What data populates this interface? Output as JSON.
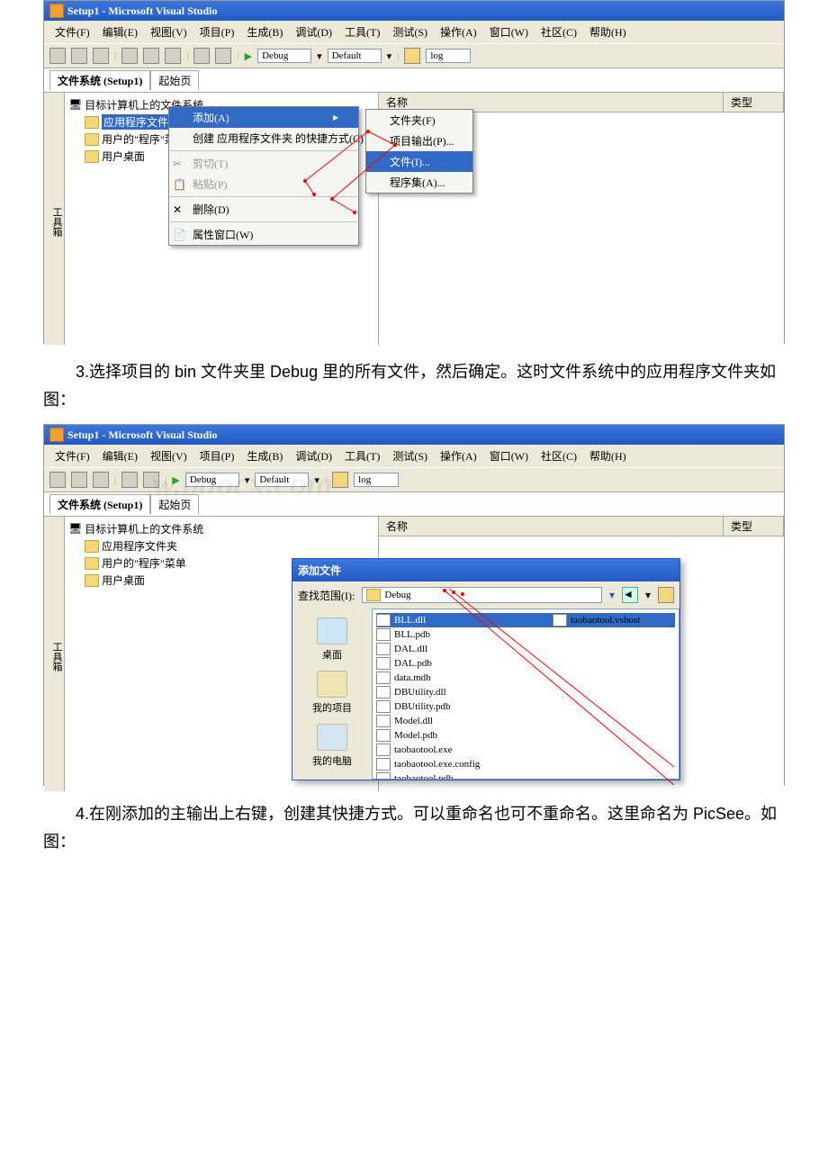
{
  "vs1": {
    "title": "Setup1 - Microsoft Visual Studio",
    "menus": [
      "文件(F)",
      "编辑(E)",
      "视图(V)",
      "项目(P)",
      "生成(B)",
      "调试(D)",
      "工具(T)",
      "测试(S)",
      "操作(A)",
      "窗口(W)",
      "社区(C)",
      "帮助(H)"
    ],
    "config": "Debug",
    "platform": "Default",
    "find": "log",
    "tab_active": "文件系统 (Setup1)",
    "tab_other": "起始页",
    "tree_root": "目标计算机上的文件系统",
    "tree_nodes": [
      "应用程序文件夹",
      "用户的\"程序\"菜单",
      "用户桌面"
    ],
    "col_name": "名称",
    "col_type": "类型",
    "cmenu1": {
      "add": "添加(A)",
      "shortcut": "创建 应用程序文件夹 的快捷方式(C)",
      "cut": "剪切(T)",
      "paste": "粘贴(P)",
      "delete": "删除(D)",
      "props": "属性窗口(W)"
    },
    "cmenu2": {
      "folder": "文件夹(F)",
      "output": "项目输出(P)...",
      "file": "文件(I)...",
      "asm": "程序集(A)..."
    },
    "toolstrip": "工具箱"
  },
  "para3": "3.选择项目的 bin 文件夹里 Debug 里的所有文件，然后确定。这时文件系统中的应用程序文件夹如图：",
  "vs2": {
    "title": "Setup1 - Microsoft Visual Studio"
  },
  "dlg": {
    "title": "添加文件",
    "lookin_label": "查找范围(I):",
    "lookin_value": "Debug",
    "places": [
      "桌面",
      "我的项目",
      "我的电脑"
    ],
    "files": [
      "BLL.dll",
      "BLL.pdb",
      "DAL.dll",
      "DAL.pdb",
      "data.mdb",
      "DBUtility.dll",
      "DBUtility.pdb",
      "Model.dll",
      "Model.pdb",
      "taobaotool.exe",
      "taobaotool.exe.config",
      "taobaotool.pdb",
      "taobaotool.vshost.exe"
    ],
    "file_right": "taobaotool.vshost"
  },
  "para4": "4.在刚添加的主输出上右键，创建其快捷方式。可以重命名也可不重命名。这里命名为 PicSee。如图："
}
